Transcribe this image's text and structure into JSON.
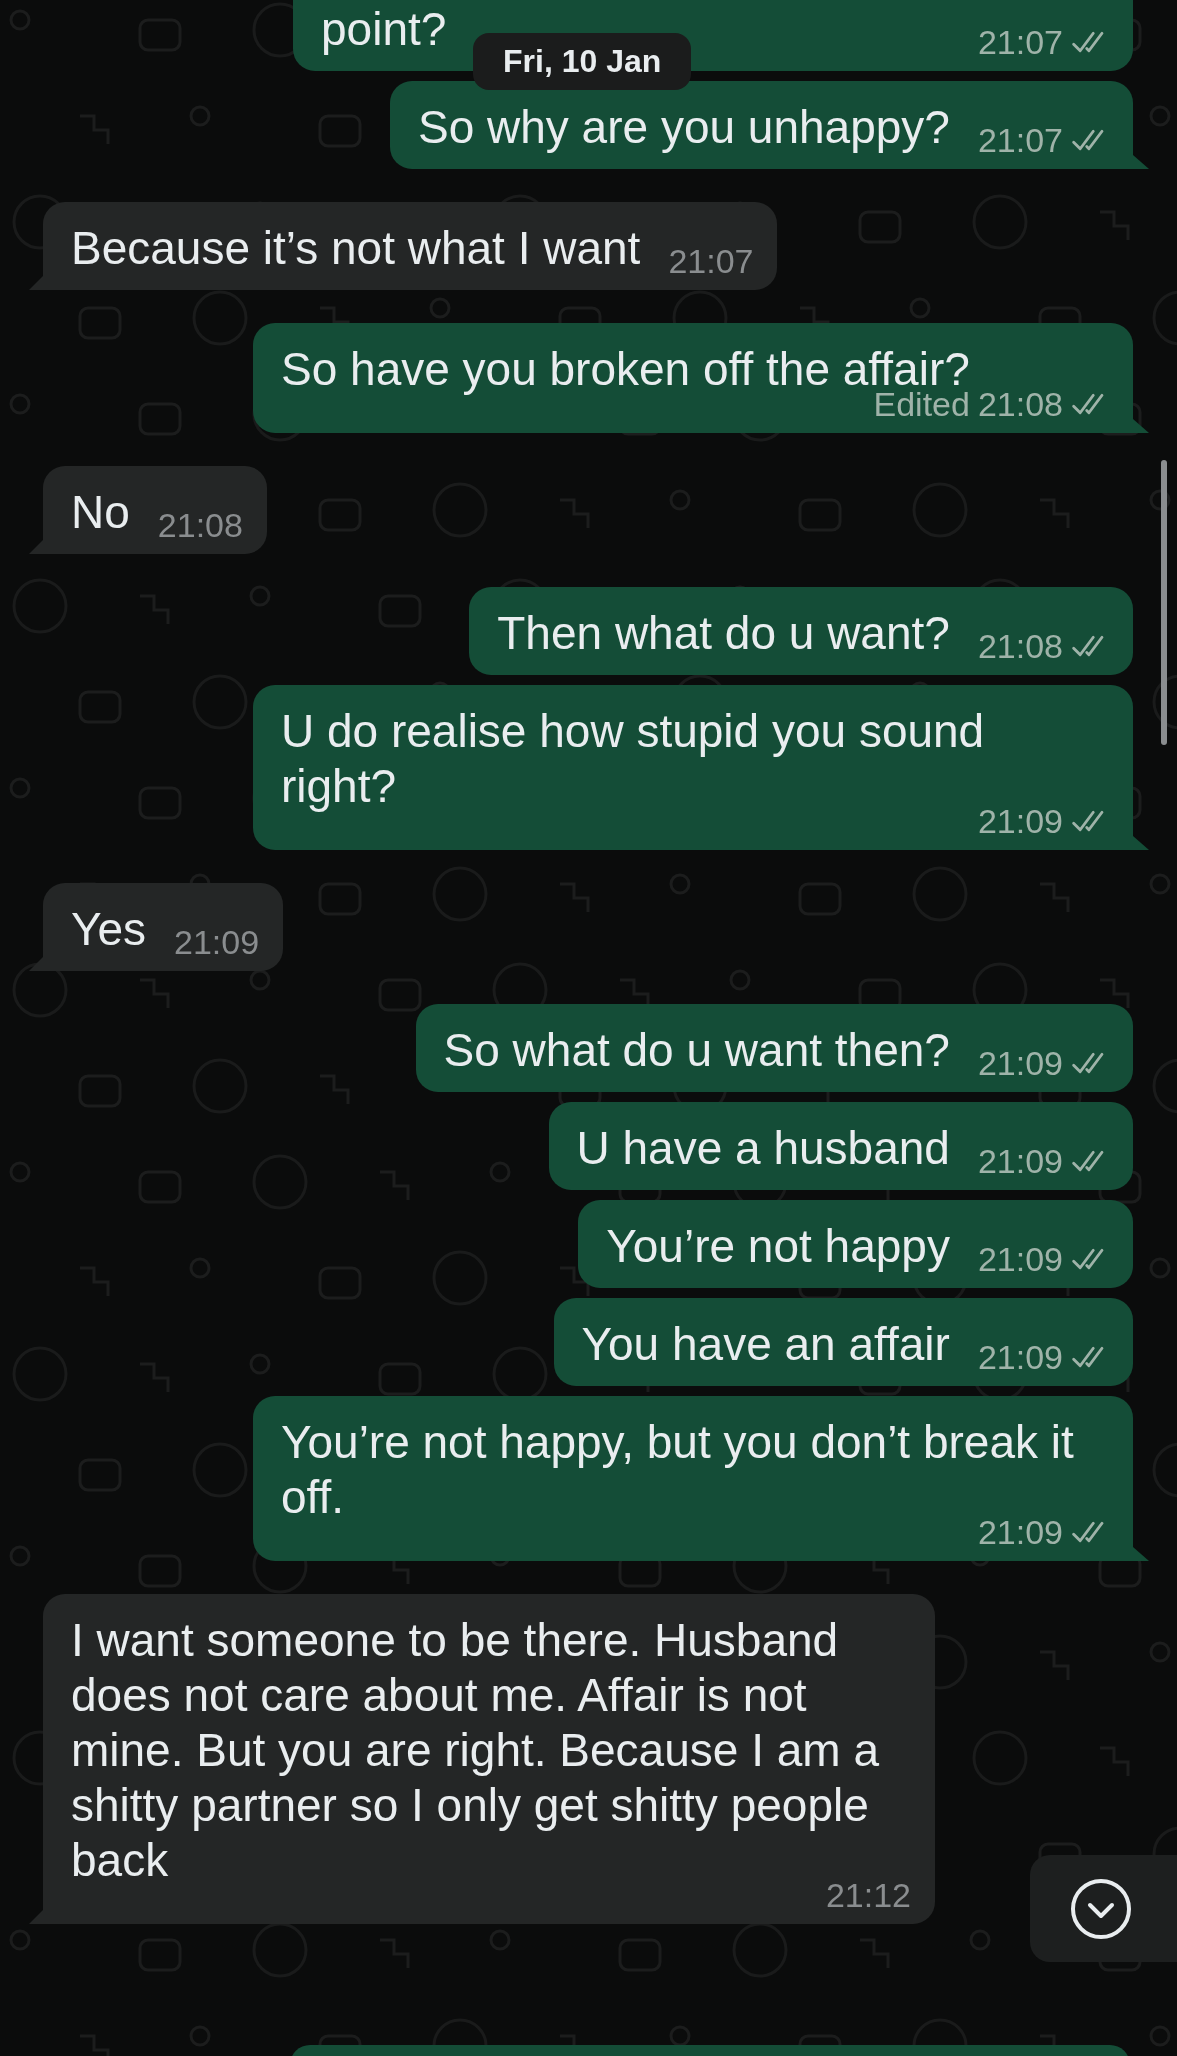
{
  "date_chip": "Fri, 10 Jan",
  "messages": [
    {
      "kind": "outgoing",
      "text": "point?",
      "time": "21:07",
      "read": false
    },
    {
      "kind": "outgoing",
      "text": "So why are you unhappy?",
      "time": "21:07",
      "read": false
    },
    {
      "kind": "incoming",
      "text": "Because it’s not what I want",
      "time": "21:07"
    },
    {
      "kind": "outgoing",
      "text": "So have you broken off the affair?",
      "edited_label": "Edited",
      "time": "21:08",
      "read": false
    },
    {
      "kind": "incoming",
      "text": "No",
      "time": "21:08"
    },
    {
      "kind": "outgoing",
      "text": "Then what do u want?",
      "time": "21:08",
      "read": false
    },
    {
      "kind": "outgoing",
      "text": "U do realise how stupid you sound right?",
      "time": "21:09",
      "read": false
    },
    {
      "kind": "incoming",
      "text": "Yes",
      "time": "21:09"
    },
    {
      "kind": "outgoing",
      "text": "So what do u want then?",
      "time": "21:09",
      "read": false
    },
    {
      "kind": "outgoing",
      "text": "U have a husband",
      "time": "21:09",
      "read": false
    },
    {
      "kind": "outgoing",
      "text": "You’re not happy",
      "time": "21:09",
      "read": false
    },
    {
      "kind": "outgoing",
      "text": "You have an affair",
      "time": "21:09",
      "read": false
    },
    {
      "kind": "outgoing",
      "text": "You’re not happy, but you don’t break it off.",
      "time": "21:09",
      "read": false
    },
    {
      "kind": "incoming",
      "text": "I want someone to be there. Husband does not care about me. Affair is not mine. But you are right. Because I am a shitty partner so I only get shitty people back",
      "time": "21:12"
    }
  ]
}
